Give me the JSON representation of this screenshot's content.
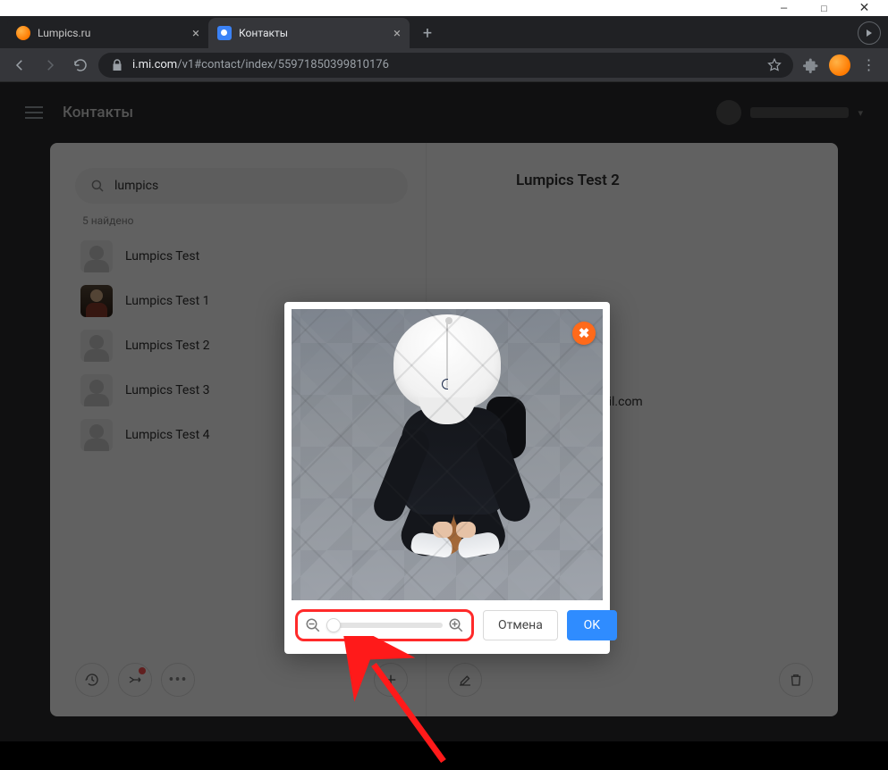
{
  "titlebar": {
    "min": "—",
    "max": "□",
    "close": "✕"
  },
  "tabs": [
    {
      "title": "Lumpics.ru",
      "active": false,
      "favicon": "orange"
    },
    {
      "title": "Контакты",
      "active": true,
      "favicon": "blue"
    }
  ],
  "addressbar": {
    "host": "i.mi.com",
    "path": "/v1#contact/index/55971850399810176"
  },
  "app": {
    "title": "Контакты",
    "search_value": "lumpics",
    "found_label": "5 найдено",
    "contacts": [
      {
        "name": "Lumpics Test",
        "avatar": "placeholder"
      },
      {
        "name": "Lumpics Test 1",
        "avatar": "dark"
      },
      {
        "name": "Lumpics Test 2",
        "avatar": "placeholder"
      },
      {
        "name": "Lumpics Test 3",
        "avatar": "placeholder"
      },
      {
        "name": "Lumpics Test 4",
        "avatar": "placeholder"
      }
    ],
    "detail": {
      "name": "Lumpics Test 2",
      "email_suffix": "ail.com"
    }
  },
  "modal": {
    "cancel_label": "Отмена",
    "ok_label": "OK",
    "close_glyph": "✖",
    "slider_value": 0
  }
}
